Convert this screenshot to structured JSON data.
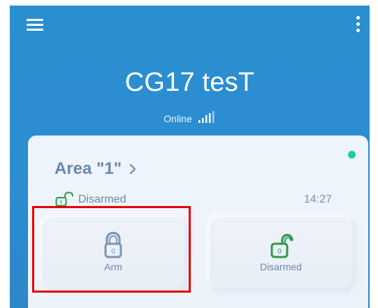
{
  "header": {
    "title": "CG17 tesT",
    "status": "Online",
    "icons": {
      "menu": "menu-icon",
      "more": "more-vertical-icon",
      "signal": "signal-bars-icon"
    }
  },
  "area": {
    "title": "Area \"1\"",
    "state_label": "Disarmed",
    "time": "14:27",
    "online_color": "#19d38a"
  },
  "actions": [
    {
      "label": "Arm",
      "icon": "lock-closed-icon",
      "color": "#7c95b5",
      "highlighted": true
    },
    {
      "label": "Disarmed",
      "icon": "lock-open-icon",
      "color": "#2b9b43",
      "highlighted": false
    }
  ],
  "colors": {
    "header_blue": "#2d8ed1",
    "card_bg": "#eef4fb",
    "accent_green": "#2b9b43",
    "highlight_red": "#e30000",
    "text_muted": "#6a88ad"
  }
}
